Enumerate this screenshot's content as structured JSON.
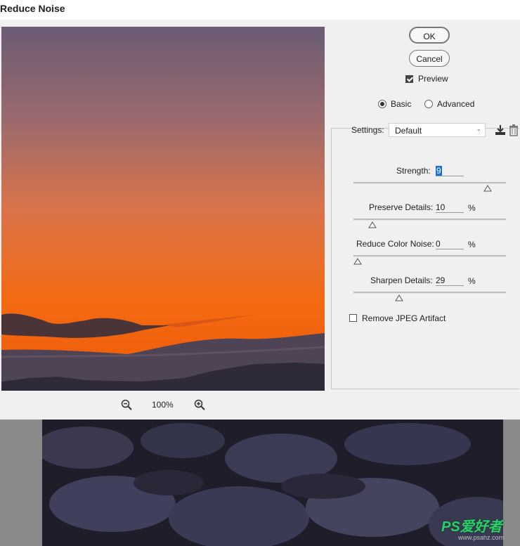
{
  "dialog": {
    "title": "Reduce Noise"
  },
  "buttons": {
    "ok": "OK",
    "cancel": "Cancel"
  },
  "preview_toggle": {
    "label": "Preview",
    "checked": true
  },
  "mode": {
    "basic": "Basic",
    "advanced": "Advanced",
    "selected": "Basic"
  },
  "settings": {
    "label": "Settings:",
    "value": "Default"
  },
  "sliders": [
    {
      "label": "Strength:",
      "value": "9",
      "unit": "",
      "level": 0.9
    },
    {
      "label": "Preserve Details:",
      "value": "10",
      "unit": "%",
      "level": 0.1
    },
    {
      "label": "Reduce Color Noise:",
      "value": "0",
      "unit": "%",
      "level": 0.0
    },
    {
      "label": "Sharpen Details:",
      "value": "29",
      "unit": "%",
      "level": 0.29
    }
  ],
  "jpeg": {
    "label": "Remove JPEG Artifact",
    "checked": false
  },
  "zoom": {
    "level": "100%"
  },
  "watermark": {
    "brand": "PS爱好者",
    "url": "www.psahz.com"
  },
  "colors": {
    "accent": "#1c6fd6",
    "sky_top": "#6c5a73",
    "sky_bottom": "#f26a12",
    "watermark": "#2bd06d"
  }
}
